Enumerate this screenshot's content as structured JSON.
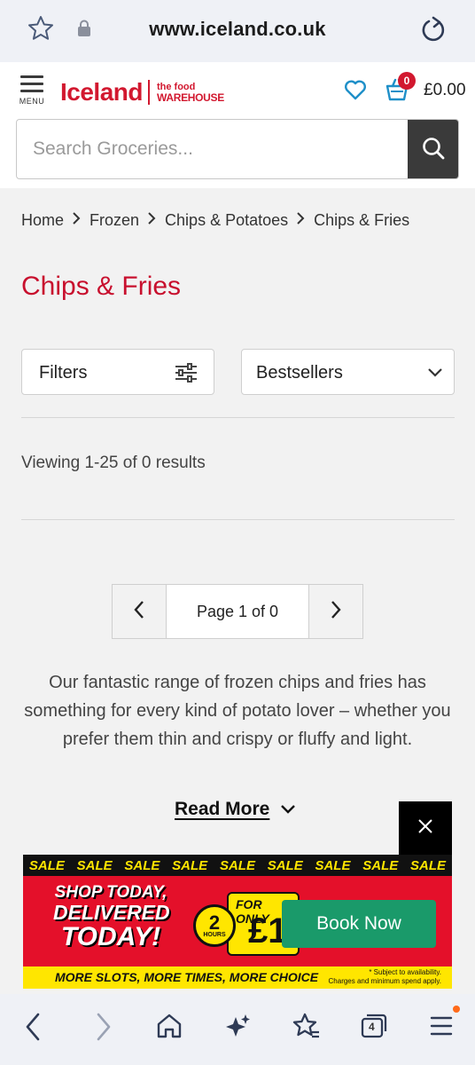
{
  "browser": {
    "url": "www.iceland.co.uk",
    "tab_count": "4"
  },
  "header": {
    "menu_label": "MENU",
    "brand": "Iceland",
    "sub_brand_line1": "the food",
    "sub_brand_line2": "WAREHOUSE",
    "basket_count": "0",
    "basket_total": "£0.00",
    "search_placeholder": "Search Groceries..."
  },
  "breadcrumb": [
    "Home",
    "Frozen",
    "Chips & Potatoes",
    "Chips & Fries"
  ],
  "main": {
    "title": "Chips & Fries",
    "filters_label": "Filters",
    "sort_value": "Bestsellers",
    "results_text": "Viewing 1-25 of 0 results",
    "page_info": "Page 1 of 0",
    "description": "Our fantastic range of frozen chips and fries has something for every kind of potato lover – whether you prefer them thin and crispy or fluffy and light.",
    "read_more": "Read More"
  },
  "ad": {
    "sale_word": "SALE",
    "headline_1": "SHOP TODAY,",
    "headline_2": "DELIVERED",
    "headline_3": "TODAY!",
    "timer_number": "2",
    "timer_unit": "HOURS",
    "for_only": "FOR ONLY",
    "price": "£1",
    "book_button": "Book Now",
    "tagline": "MORE SLOTS, MORE TIMES, MORE CHOICE",
    "small_print_1": "* Subject to availability.",
    "small_print_2": "Charges and minimum spend apply."
  },
  "colors": {
    "brand_red": "#d2182f",
    "title_red": "#c8102e",
    "book_green": "#1a9a6a",
    "ad_yellow": "#ffe600"
  }
}
